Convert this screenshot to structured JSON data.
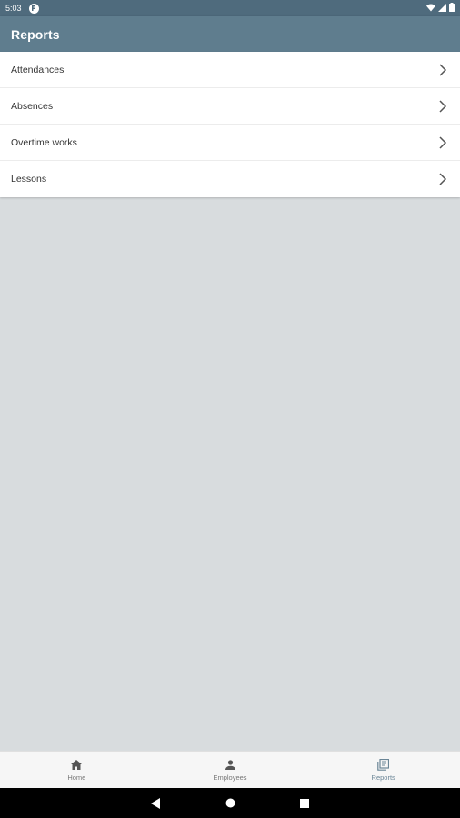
{
  "status_bar": {
    "time": "5:03",
    "icons": [
      "app-notification-icon",
      "wifi-icon",
      "signal-icon",
      "battery-icon"
    ]
  },
  "app_bar": {
    "title": "Reports"
  },
  "reports": {
    "items": [
      {
        "label": "Attendances",
        "icon": "chevron-right-icon"
      },
      {
        "label": "Absences",
        "icon": "chevron-right-icon"
      },
      {
        "label": "Overtime works",
        "icon": "chevron-right-icon"
      },
      {
        "label": "Lessons",
        "icon": "chevron-right-icon"
      }
    ]
  },
  "bottom_nav": {
    "items": [
      {
        "label": "Home",
        "icon": "home-icon",
        "active": false
      },
      {
        "label": "Employees",
        "icon": "person-icon",
        "active": false
      },
      {
        "label": "Reports",
        "icon": "reports-icon",
        "active": true
      }
    ]
  },
  "system_nav": {
    "buttons": [
      "back-icon",
      "home-circle-icon",
      "recents-icon"
    ]
  },
  "colors": {
    "status_bar": "#4f6b7d",
    "app_bar": "#5f7d8e",
    "background": "#d8dcde",
    "active_nav": "#6a8596"
  }
}
